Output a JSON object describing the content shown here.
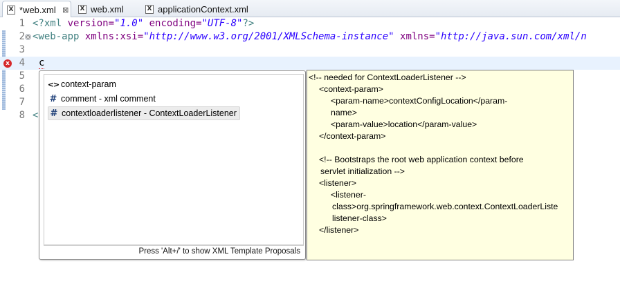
{
  "tabs": [
    {
      "label": "*web.xml",
      "icon": "xml-file-icon",
      "active": true,
      "has_close": true
    },
    {
      "label": "web.xml",
      "icon": "xml-file-icon",
      "active": false
    },
    {
      "label": "applicationContext.xml",
      "icon": "xml-file-icon",
      "active": false
    }
  ],
  "editor": {
    "line_numbers": [
      "1",
      "2",
      "3",
      "4",
      "5",
      "6",
      "7",
      "8"
    ],
    "line1": {
      "pi_open": "<?xml",
      "version_attr": " version=",
      "version_val": "\"1.0\"",
      "encoding_attr": " encoding=",
      "encoding_val": "\"UTF-8\"",
      "pi_close": "?>"
    },
    "line2": {
      "tag_open": "<web-app",
      "xsi_attr": " xmlns:xsi=",
      "xsi_val": "\"http://www.w3.org/2001/XMLSchema-instance\"",
      "xmlns_attr": " xmlns=",
      "xmlns_val": "\"http://java.sun.com/xml/n"
    },
    "line4_typed": "c",
    "line8_partial": "<",
    "fold_symbol": "⊖",
    "error_icon": "x"
  },
  "content_assist": {
    "proposals": [
      {
        "icon": "<>",
        "icon_name": "tag-proposal-icon",
        "label": "context-param",
        "selected": false
      },
      {
        "icon": "#",
        "icon_name": "template-proposal-icon",
        "label": "comment - xml comment",
        "selected": false
      },
      {
        "icon": "#",
        "icon_name": "template-proposal-icon",
        "label": "contextloaderlistener - ContextLoaderListener",
        "selected": true
      }
    ],
    "status": "Press 'Alt+/' to show XML Template Proposals"
  },
  "info_popup": {
    "lines": [
      "<!-- needed for ContextLoaderListener -->",
      "<context-param>",
      "<param-name>contextConfigLocation</param-",
      "name>",
      "<param-value>location</param-value>",
      "</context-param>",
      "",
      "<!-- Bootstraps the root web application context before",
      "servlet initialization -->",
      "<listener>",
      "<listener-",
      "class>org.springframework.web.context.ContextLoaderListe",
      "listener-class>",
      "</listener>"
    ]
  },
  "colors": {
    "tag": "#3f7f7f",
    "attribute": "#7f007f",
    "value": "#2a00ff",
    "current_line": "#e8f2fe",
    "info_background": "#ffffe1",
    "error": "#d6282b"
  }
}
